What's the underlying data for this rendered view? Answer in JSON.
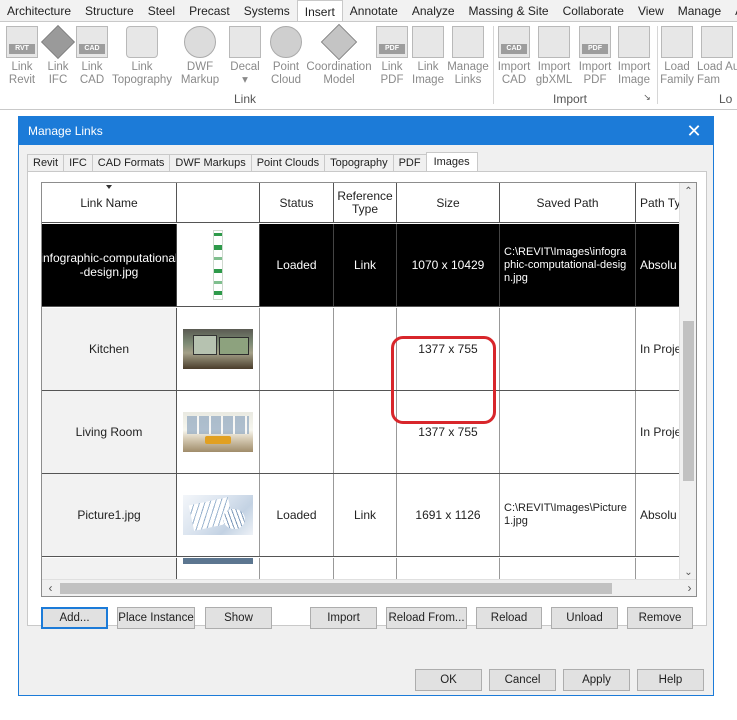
{
  "ribbon": {
    "tabs": [
      "Architecture",
      "Structure",
      "Steel",
      "Precast",
      "Systems",
      "Insert",
      "Annotate",
      "Analyze",
      "Massing & Site",
      "Collaborate",
      "View",
      "Manage",
      "Ad"
    ],
    "active_tab": "Insert",
    "buttons": [
      {
        "label": "Link\nRevit",
        "icon": "link-revit-icon",
        "tag": "RVT"
      },
      {
        "label": "Link\nIFC",
        "icon": "link-ifc-icon",
        "tag": ""
      },
      {
        "label": "Link\nCAD",
        "icon": "link-cad-icon",
        "tag": "CAD"
      },
      {
        "label": "Link\nTopography",
        "icon": "link-topography-icon",
        "tag": ""
      },
      {
        "label": "DWF\nMarkup",
        "icon": "dwf-markup-icon",
        "tag": ""
      },
      {
        "label": "Decal\n▾",
        "icon": "decal-icon",
        "tag": ""
      },
      {
        "label": "Point\nCloud",
        "icon": "point-cloud-icon",
        "tag": ""
      },
      {
        "label": "Coordination\nModel",
        "icon": "coordination-model-icon",
        "tag": ""
      },
      {
        "label": "Link\nPDF",
        "icon": "link-pdf-icon",
        "tag": "PDF"
      },
      {
        "label": "Link\nImage",
        "icon": "link-image-icon",
        "tag": ""
      },
      {
        "label": "Manage\nLinks",
        "icon": "manage-links-icon",
        "tag": ""
      },
      {
        "label": "Import\nCAD",
        "icon": "import-cad-icon",
        "tag": "CAD"
      },
      {
        "label": "Import\ngbXML",
        "icon": "import-gbxml-icon",
        "tag": ""
      },
      {
        "label": "Import\nPDF",
        "icon": "import-pdf-icon",
        "tag": "PDF"
      },
      {
        "label": "Import\nImage",
        "icon": "import-image-icon",
        "tag": ""
      },
      {
        "label": "Load\nFamily",
        "icon": "load-family-icon",
        "tag": ""
      },
      {
        "label": "Load Au\nFam",
        "icon": "load-autodesk-family-icon",
        "tag": ""
      }
    ],
    "panels": [
      "Link",
      "Import",
      "Lo"
    ],
    "panel_launcher": "↘"
  },
  "dialog": {
    "title": "Manage Links",
    "close_glyph": "✕",
    "tabs": [
      "Revit",
      "IFC",
      "CAD Formats",
      "DWF Markups",
      "Point Clouds",
      "Topography",
      "PDF",
      "Images"
    ],
    "active_tab": "Images",
    "columns": [
      "Link Name",
      "",
      "Status",
      "Reference\nType",
      "Size",
      "Saved Path",
      "Path Ty"
    ],
    "rows": [
      {
        "name": "infographic-computational\n-design.jpg",
        "thumb": "infographic",
        "status": "Loaded",
        "ref_type": "Link",
        "size": "1070 x 10429",
        "saved_path": "C:\\REVIT\\Images\\infographic-computational-design.jpg",
        "path_type": "Absolu",
        "selected": true
      },
      {
        "name": "Kitchen",
        "thumb": "kitchen",
        "status": "",
        "ref_type": "",
        "size": "1377 x 755",
        "saved_path": "",
        "path_type": "In Proje",
        "selected": false
      },
      {
        "name": "Living Room",
        "thumb": "living",
        "status": "",
        "ref_type": "",
        "size": "1377 x 755",
        "saved_path": "",
        "path_type": "In Proje",
        "selected": false
      },
      {
        "name": "Picture1.jpg",
        "thumb": "picture",
        "status": "Loaded",
        "ref_type": "Link",
        "size": "1691 x 1126",
        "saved_path": "C:\\REVIT\\Images\\Picture1.jpg",
        "path_type": "Absolu",
        "selected": false
      }
    ],
    "scroll_glyphs": {
      "up": "⌃",
      "down": "⌄",
      "left": "‹",
      "right": "›"
    },
    "action_buttons": [
      "Add...",
      "Place Instance",
      "Show",
      "Import",
      "Reload From...",
      "Reload",
      "Unload",
      "Remove"
    ],
    "footer_buttons": [
      "OK",
      "Cancel",
      "Apply",
      "Help"
    ]
  },
  "colors": {
    "accent": "#1c7bd8",
    "highlight": "#d8262b",
    "selected_row": "#000000"
  }
}
